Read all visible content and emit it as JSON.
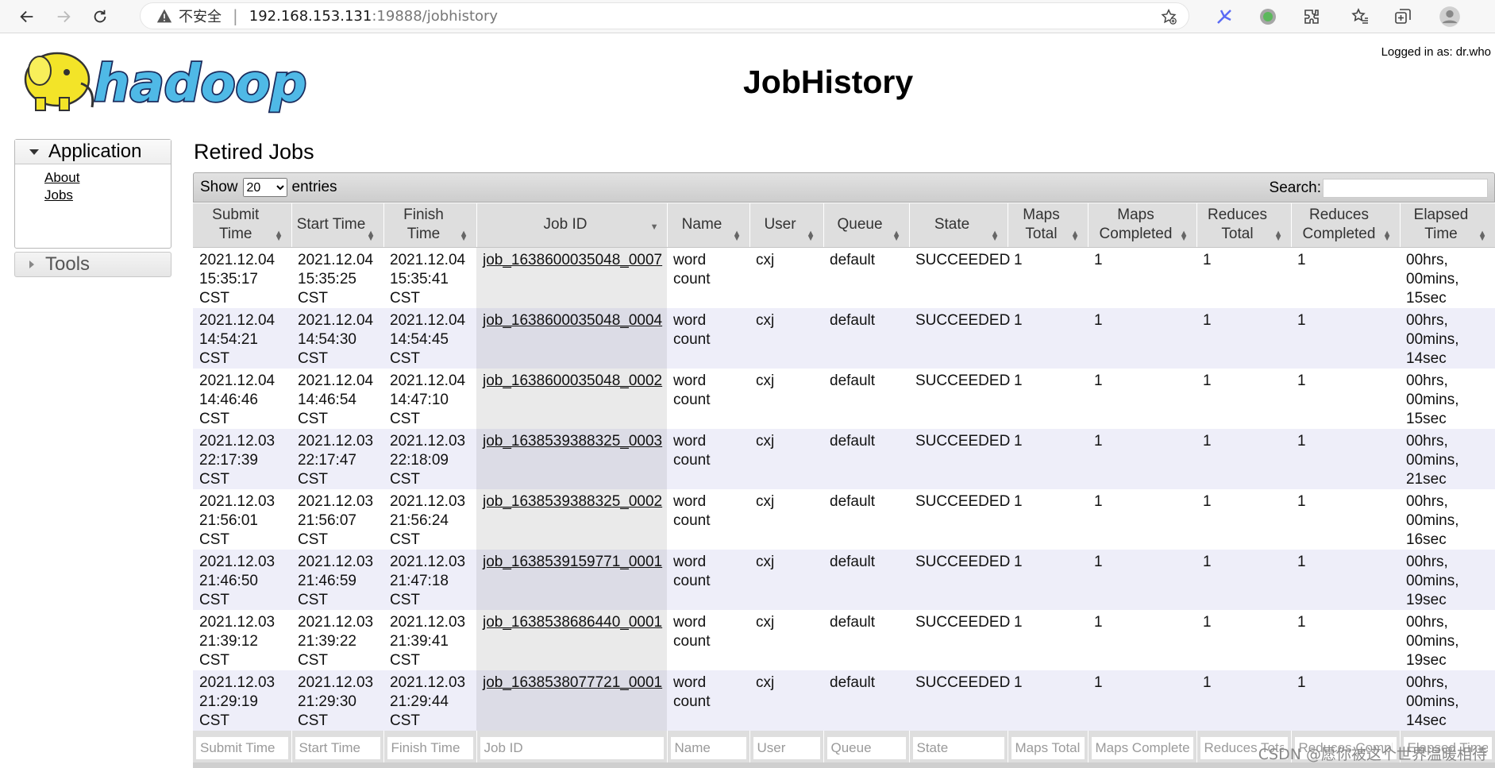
{
  "browser": {
    "insecure_label": "不安全",
    "url_host": "192.168.153.131",
    "url_rest": ":19888/jobhistory"
  },
  "header": {
    "logged_in": "Logged in as: dr.who",
    "title": "JobHistory",
    "logo_text": "hadoop"
  },
  "sidebar": {
    "application": "Application",
    "links": [
      "About",
      "Jobs"
    ],
    "tools": "Tools"
  },
  "main": {
    "section_title": "Retired Jobs",
    "show_label": "Show",
    "entries_selected": "20",
    "entries_label": "entries",
    "search_label": "Search:"
  },
  "table": {
    "headers": [
      [
        "Submit",
        "Time"
      ],
      [
        "Start Time"
      ],
      [
        "Finish Time"
      ],
      [
        "Job ID"
      ],
      [
        "Name"
      ],
      [
        "User"
      ],
      [
        "Queue"
      ],
      [
        "State"
      ],
      [
        "Maps",
        "Total"
      ],
      [
        "Maps",
        "Completed"
      ],
      [
        "Reduces",
        "Total"
      ],
      [
        "Reduces",
        "Completed"
      ],
      [
        "Elapsed",
        "Time"
      ]
    ],
    "rows": [
      [
        "2021.12.04 15:35:17 CST",
        "2021.12.04 15:35:25 CST",
        "2021.12.04 15:35:41 CST",
        "job_1638600035048_0007",
        "word count",
        "cxj",
        "default",
        "SUCCEEDED",
        "1",
        "1",
        "1",
        "1",
        "00hrs, 00mins, 15sec"
      ],
      [
        "2021.12.04 14:54:21 CST",
        "2021.12.04 14:54:30 CST",
        "2021.12.04 14:54:45 CST",
        "job_1638600035048_0004",
        "word count",
        "cxj",
        "default",
        "SUCCEEDED",
        "1",
        "1",
        "1",
        "1",
        "00hrs, 00mins, 14sec"
      ],
      [
        "2021.12.04 14:46:46 CST",
        "2021.12.04 14:46:54 CST",
        "2021.12.04 14:47:10 CST",
        "job_1638600035048_0002",
        "word count",
        "cxj",
        "default",
        "SUCCEEDED",
        "1",
        "1",
        "1",
        "1",
        "00hrs, 00mins, 15sec"
      ],
      [
        "2021.12.03 22:17:39 CST",
        "2021.12.03 22:17:47 CST",
        "2021.12.03 22:18:09 CST",
        "job_1638539388325_0003",
        "word count",
        "cxj",
        "default",
        "SUCCEEDED",
        "1",
        "1",
        "1",
        "1",
        "00hrs, 00mins, 21sec"
      ],
      [
        "2021.12.03 21:56:01 CST",
        "2021.12.03 21:56:07 CST",
        "2021.12.03 21:56:24 CST",
        "job_1638539388325_0002",
        "word count",
        "cxj",
        "default",
        "SUCCEEDED",
        "1",
        "1",
        "1",
        "1",
        "00hrs, 00mins, 16sec"
      ],
      [
        "2021.12.03 21:46:50 CST",
        "2021.12.03 21:46:59 CST",
        "2021.12.03 21:47:18 CST",
        "job_1638539159771_0001",
        "word count",
        "cxj",
        "default",
        "SUCCEEDED",
        "1",
        "1",
        "1",
        "1",
        "00hrs, 00mins, 19sec"
      ],
      [
        "2021.12.03 21:39:12 CST",
        "2021.12.03 21:39:22 CST",
        "2021.12.03 21:39:41 CST",
        "job_1638538686440_0001",
        "word count",
        "cxj",
        "default",
        "SUCCEEDED",
        "1",
        "1",
        "1",
        "1",
        "00hrs, 00mins, 19sec"
      ],
      [
        "2021.12.03 21:29:19 CST",
        "2021.12.03 21:29:30 CST",
        "2021.12.03 21:29:44 CST",
        "job_1638538077721_0001",
        "word count",
        "cxj",
        "default",
        "SUCCEEDED",
        "1",
        "1",
        "1",
        "1",
        "00hrs, 00mins, 14sec"
      ]
    ],
    "filters": [
      "Submit Time",
      "Start Time",
      "Finish Time",
      "Job ID",
      "Name",
      "User",
      "Queue",
      "State",
      "Maps Total",
      "Maps Complete",
      "Reduces Tota",
      "Reduces Compl",
      "Elapsed Time"
    ]
  },
  "watermark": "CSDN @愿你被这个世界温暖相待",
  "colors": {
    "row_even": "#eeeef9",
    "header_bg": "#dedede",
    "sorted_col": "#dcdce6"
  },
  "icons": [
    "back-icon",
    "forward-icon",
    "reload-icon",
    "warning-icon",
    "favorite-add-icon",
    "extension-icon",
    "collections-icon",
    "profile-icon"
  ]
}
